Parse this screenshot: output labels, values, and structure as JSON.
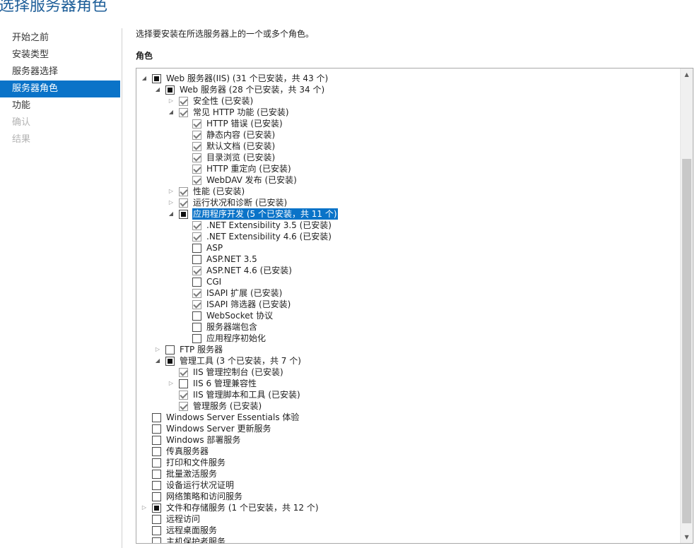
{
  "page": {
    "title": "选择服务器角色"
  },
  "nav": {
    "items": [
      {
        "label": "开始之前",
        "state": "normal"
      },
      {
        "label": "安装类型",
        "state": "normal"
      },
      {
        "label": "服务器选择",
        "state": "normal"
      },
      {
        "label": "服务器角色",
        "state": "active"
      },
      {
        "label": "功能",
        "state": "normal"
      },
      {
        "label": "确认",
        "state": "disabled"
      },
      {
        "label": "结果",
        "state": "disabled"
      }
    ]
  },
  "main": {
    "description": "选择要安装在所选服务器上的一个或多个角色。",
    "roles_label": "角色"
  },
  "tree": {
    "rows": [
      {
        "level": 0,
        "expander": "expanded",
        "check": "partial",
        "label": "Web 服务器(IIS) (31 个已安装，共 43 个)"
      },
      {
        "level": 1,
        "expander": "expanded",
        "check": "partial",
        "label": "Web 服务器 (28 个已安装，共 34 个)"
      },
      {
        "level": 2,
        "expander": "collapsed",
        "check": "checked",
        "label": "安全性 (已安装)"
      },
      {
        "level": 2,
        "expander": "expanded",
        "check": "checked",
        "label": "常见 HTTP 功能 (已安装)"
      },
      {
        "level": 3,
        "expander": "none",
        "check": "checked",
        "label": "HTTP 错误 (已安装)"
      },
      {
        "level": 3,
        "expander": "none",
        "check": "checked",
        "label": "静态内容 (已安装)"
      },
      {
        "level": 3,
        "expander": "none",
        "check": "checked",
        "label": "默认文档 (已安装)"
      },
      {
        "level": 3,
        "expander": "none",
        "check": "checked",
        "label": "目录浏览 (已安装)"
      },
      {
        "level": 3,
        "expander": "none",
        "check": "checked",
        "label": "HTTP 重定向 (已安装)"
      },
      {
        "level": 3,
        "expander": "none",
        "check": "checked",
        "label": "WebDAV 发布 (已安装)"
      },
      {
        "level": 2,
        "expander": "collapsed",
        "check": "checked",
        "label": "性能 (已安装)"
      },
      {
        "level": 2,
        "expander": "collapsed",
        "check": "checked",
        "label": "运行状况和诊断 (已安装)"
      },
      {
        "level": 2,
        "expander": "expanded",
        "check": "partial",
        "label": "应用程序开发 (5 个已安装，共 11 个)",
        "selected": true
      },
      {
        "level": 3,
        "expander": "none",
        "check": "checked",
        "label": ".NET Extensibility 3.5 (已安装)"
      },
      {
        "level": 3,
        "expander": "none",
        "check": "checked",
        "label": ".NET Extensibility 4.6 (已安装)"
      },
      {
        "level": 3,
        "expander": "none",
        "check": "unchecked",
        "label": "ASP"
      },
      {
        "level": 3,
        "expander": "none",
        "check": "unchecked",
        "label": "ASP.NET 3.5"
      },
      {
        "level": 3,
        "expander": "none",
        "check": "checked",
        "label": "ASP.NET 4.6 (已安装)"
      },
      {
        "level": 3,
        "expander": "none",
        "check": "unchecked",
        "label": "CGI"
      },
      {
        "level": 3,
        "expander": "none",
        "check": "checked",
        "label": "ISAPI 扩展 (已安装)"
      },
      {
        "level": 3,
        "expander": "none",
        "check": "checked",
        "label": "ISAPI 筛选器 (已安装)"
      },
      {
        "level": 3,
        "expander": "none",
        "check": "unchecked",
        "label": "WebSocket 协议"
      },
      {
        "level": 3,
        "expander": "none",
        "check": "unchecked",
        "label": "服务器端包含"
      },
      {
        "level": 3,
        "expander": "none",
        "check": "unchecked",
        "label": "应用程序初始化"
      },
      {
        "level": 1,
        "expander": "collapsed",
        "check": "unchecked",
        "label": "FTP 服务器"
      },
      {
        "level": 1,
        "expander": "expanded",
        "check": "partial",
        "label": "管理工具 (3 个已安装，共 7 个)"
      },
      {
        "level": 2,
        "expander": "none",
        "check": "checked",
        "label": "IIS 管理控制台 (已安装)"
      },
      {
        "level": 2,
        "expander": "collapsed",
        "check": "unchecked",
        "label": "IIS 6 管理兼容性"
      },
      {
        "level": 2,
        "expander": "none",
        "check": "checked",
        "label": "IIS 管理脚本和工具 (已安装)"
      },
      {
        "level": 2,
        "expander": "none",
        "check": "checked",
        "label": "管理服务 (已安装)"
      },
      {
        "level": 0,
        "expander": "none",
        "check": "unchecked",
        "label": "Windows Server Essentials 体验"
      },
      {
        "level": 0,
        "expander": "none",
        "check": "unchecked",
        "label": "Windows Server 更新服务"
      },
      {
        "level": 0,
        "expander": "none",
        "check": "unchecked",
        "label": "Windows 部署服务"
      },
      {
        "level": 0,
        "expander": "none",
        "check": "unchecked",
        "label": "传真服务器"
      },
      {
        "level": 0,
        "expander": "none",
        "check": "unchecked",
        "label": "打印和文件服务"
      },
      {
        "level": 0,
        "expander": "none",
        "check": "unchecked",
        "label": "批量激活服务"
      },
      {
        "level": 0,
        "expander": "none",
        "check": "unchecked",
        "label": "设备运行状况证明"
      },
      {
        "level": 0,
        "expander": "none",
        "check": "unchecked",
        "label": "网络策略和访问服务"
      },
      {
        "level": 0,
        "expander": "collapsed",
        "check": "partial",
        "label": "文件和存储服务 (1 个已安装，共 12 个)"
      },
      {
        "level": 0,
        "expander": "none",
        "check": "unchecked",
        "label": "远程访问"
      },
      {
        "level": 0,
        "expander": "none",
        "check": "unchecked",
        "label": "远程桌面服务"
      },
      {
        "level": 0,
        "expander": "none",
        "check": "unchecked",
        "label": "主机保护者服务"
      }
    ]
  },
  "icons": {
    "expanded": "triangle-down-right-icon",
    "collapsed": "triangle-right-icon",
    "scroll_up": "scroll-up-arrow-icon",
    "scroll_down": "scroll-down-arrow-icon"
  },
  "colors": {
    "accent": "#0a73c8",
    "title": "#1f5f99",
    "disabled_text": "#b4b4b4"
  }
}
